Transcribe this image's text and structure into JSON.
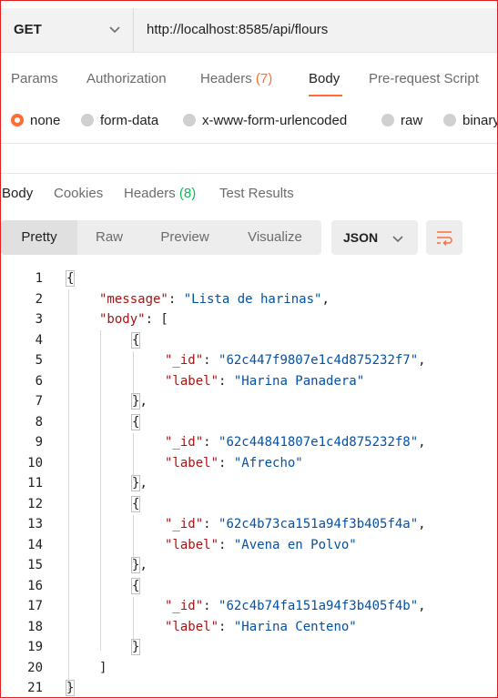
{
  "request": {
    "method": "GET",
    "url": "http://localhost:8585/api/flours"
  },
  "request_tabs": [
    {
      "label": "Params"
    },
    {
      "label": "Authorization"
    },
    {
      "label": "Headers",
      "count": "(7)"
    },
    {
      "label": "Body"
    },
    {
      "label": "Pre-request Script"
    }
  ],
  "body_types": [
    "none",
    "form-data",
    "x-www-form-urlencoded",
    "raw",
    "binary"
  ],
  "selected_body_type": "none",
  "response_tabs": [
    {
      "label": "Body"
    },
    {
      "label": "Cookies"
    },
    {
      "label": "Headers",
      "count": "(8)"
    },
    {
      "label": "Test Results"
    }
  ],
  "view_modes": [
    "Pretty",
    "Raw",
    "Preview",
    "Visualize"
  ],
  "format": "JSON",
  "line_numbers": [
    "1",
    "2",
    "3",
    "4",
    "5",
    "6",
    "7",
    "8",
    "9",
    "10",
    "11",
    "12",
    "13",
    "14",
    "15",
    "16",
    "17",
    "18",
    "19",
    "20",
    "21"
  ],
  "response_json": {
    "message_key": "\"message\"",
    "message_value": "\"Lista de harinas\"",
    "body_key": "\"body\"",
    "id_key": "\"_id\"",
    "label_key": "\"label\"",
    "items": [
      {
        "id": "\"62c447f9807e1c4d875232f7\"",
        "label": "\"Harina Panadera\""
      },
      {
        "id": "\"62c44841807e1c4d875232f8\"",
        "label": "\"Afrecho\""
      },
      {
        "id": "\"62c4b73ca151a94f3b405f4a\"",
        "label": "\"Avena en Polvo\""
      },
      {
        "id": "\"62c4b74fa151a94f3b405f4b\"",
        "label": "\"Harina Centeno\""
      }
    ]
  },
  "colors": {
    "accent": "#ff6c37",
    "count_green": "#0cbb52",
    "json_key": "#a31515",
    "json_string": "#0451a5"
  },
  "icons": {
    "method_dropdown": "chevron-down-icon",
    "format_dropdown": "chevron-down-icon",
    "wrap": "wrap-lines-icon"
  }
}
